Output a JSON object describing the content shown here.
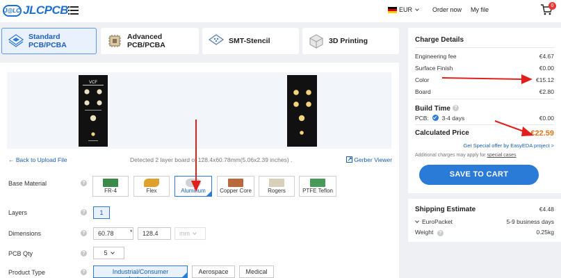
{
  "header": {
    "logo_badge": "J@LC",
    "logo_text": "JLCPCB",
    "currency": "EUR",
    "order_now": "Order now",
    "my_file": "My file",
    "cart_count": "0"
  },
  "tabs": [
    {
      "label": "Standard PCB/PCBA",
      "active": true
    },
    {
      "label": "Advanced PCB/PCBA",
      "active": false
    },
    {
      "label": "SMT-Stencil",
      "active": false
    },
    {
      "label": "3D Printing",
      "active": false
    }
  ],
  "preview": {
    "board_label": "VCF",
    "back_link": "Back to Upload File",
    "detected": "Detected 2 layer board of 128.4x60.78mm(5.06x2.39 inches) .",
    "gerber_viewer": "Gerber Viewer"
  },
  "form": {
    "base_material_label": "Base Material",
    "materials": [
      "FR-4",
      "Flex",
      "Aluminum",
      "Copper Core",
      "Rogers",
      "PTFE Teflon"
    ],
    "selected_material": "Aluminum",
    "layers_label": "Layers",
    "layers_value": "1",
    "dimensions_label": "Dimensions",
    "dim_width": "60.78",
    "dim_sep": "*",
    "dim_height": "128.4",
    "dim_unit": "mm",
    "pcb_qty_label": "PCB Qty",
    "pcb_qty_value": "5",
    "product_type_label": "Product Type",
    "product_types": [
      "Industrial/Consumer electronics",
      "Aerospace",
      "Medical"
    ]
  },
  "charges": {
    "title": "Charge Details",
    "engineering_fee_label": "Engineering fee",
    "engineering_fee": "€4.67",
    "surface_finish_label": "Surface Finish",
    "surface_finish": "€0.00",
    "color_label": "Color",
    "color": "€15.12",
    "board_label": "Board",
    "board": "€2.80",
    "build_time_label": "Build Time",
    "pcb_label": "PCB:",
    "pcb_days": "3-4 days",
    "pcb_time_cost": "€0.00",
    "calc_price_label": "Calculated Price",
    "calc_price": "€22.59",
    "special_offer": "Get Special offer by EasyEDA project >",
    "additional_prefix": "Additional charges may apply for",
    "additional_link": "special cases",
    "save_button": "SAVE TO CART"
  },
  "shipping": {
    "title": "Shipping Estimate",
    "cost": "€4.48",
    "method": "EuroPacket",
    "days": "5-9 business days",
    "weight_label": "Weight",
    "weight": "0.25kg"
  },
  "colors": {
    "accent": "#2a7ad8",
    "price_orange": "#e8731a",
    "annotation_red": "#e0201c"
  }
}
